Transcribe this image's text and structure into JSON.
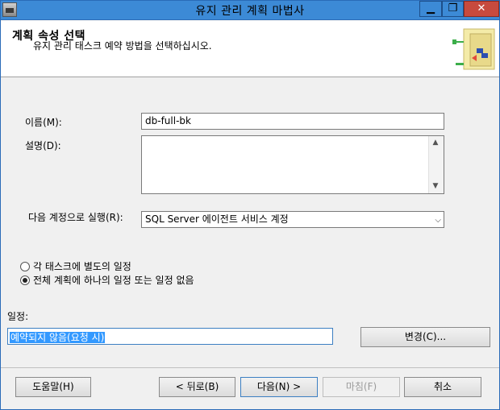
{
  "window": {
    "title": "유지 관리 계획 마법사",
    "buttons": {
      "min": "▁",
      "max": "❐",
      "close": "✕"
    }
  },
  "header": {
    "title": "계획 속성 선택",
    "subtitle": "유지 관리 태스크 예약 방법을 선택하십시오."
  },
  "form": {
    "name_label": "이름(M):",
    "name_value": "db-full-bk",
    "description_label": "설명(D):",
    "description_value": "",
    "run_as_label": "다음 계정으로 실행(R):",
    "run_as_value": "SQL Server 에이전트 서비스 계정"
  },
  "radios": [
    {
      "label": "각 태스크에 별도의 일정",
      "checked": false
    },
    {
      "label": "전체 계획에 하나의 일정 또는 일정 없음",
      "checked": true
    }
  ],
  "schedule": {
    "label": "일정:",
    "value": "예약되지 않음(요청 시)",
    "change_button": "변경(C)..."
  },
  "footer": {
    "help": "도움말(H)",
    "back": "< 뒤로(B)",
    "next": "다음(N) >",
    "finish": "마침(F)",
    "cancel": "취소"
  }
}
